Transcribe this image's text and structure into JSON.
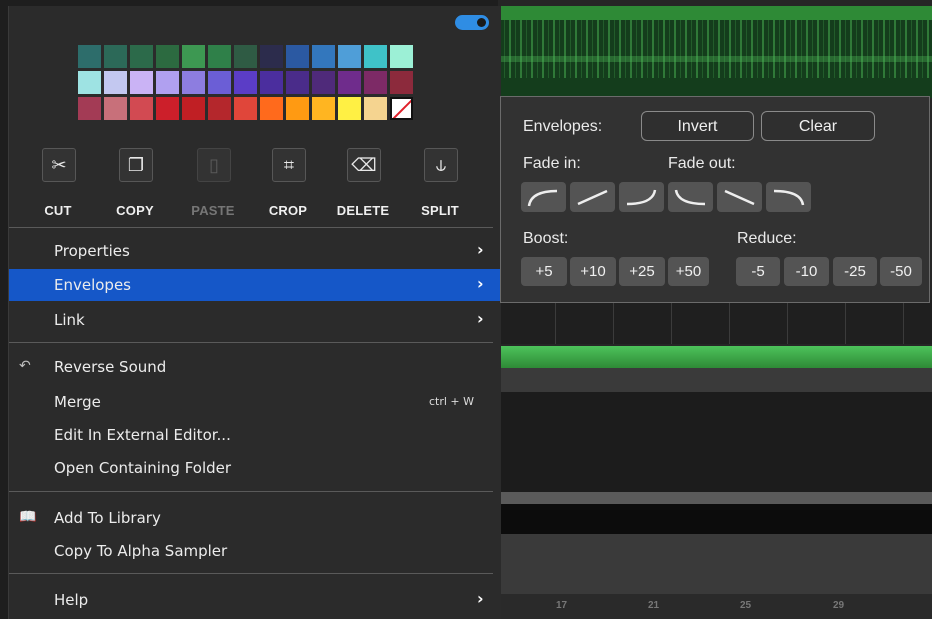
{
  "toggle": {
    "state": "on",
    "color": "#2f8de4"
  },
  "palette": {
    "rows": [
      [
        "#2d6d6b",
        "#2c6958",
        "#2c6a4a",
        "#2c6a40",
        "#3d9852",
        "#2f8049",
        "#2f5b44",
        "#2c2c4c",
        "#2b59a2",
        "#3377bd",
        "#4f9ed8",
        "#3fc2c8",
        "#9cf0d6"
      ],
      [
        "#9ee3e3",
        "#c3c8f0",
        "#cab3f5",
        "#b0a0f0",
        "#8d7de0",
        "#6b5ed6",
        "#5b3dc6",
        "#4b2e9e",
        "#4a2c8a",
        "#4f2a7a",
        "#6f2c8c",
        "#7d2a66",
        "#8c2a3c"
      ],
      [
        "#a33b55",
        "#c8707a",
        "#d24a52",
        "#cc1f2a",
        "#c01f24",
        "#b4272c",
        "#e0463a",
        "#ff6a1c",
        "#ff9a12",
        "#ffb521",
        "#fff044",
        "#f5d490",
        "none"
      ]
    ]
  },
  "tools": [
    {
      "label": "CUT",
      "icon": "scissors-icon",
      "glyph": "✂",
      "enabled": true
    },
    {
      "label": "COPY",
      "icon": "copy-icon",
      "glyph": "❐",
      "enabled": true
    },
    {
      "label": "PASTE",
      "icon": "clipboard-icon",
      "glyph": "▯",
      "enabled": false
    },
    {
      "label": "CROP",
      "icon": "crop-icon",
      "glyph": "⌗",
      "enabled": true
    },
    {
      "label": "DELETE",
      "icon": "backspace-icon",
      "glyph": "⌫",
      "enabled": true
    },
    {
      "label": "SPLIT",
      "icon": "split-icon",
      "glyph": "⫝",
      "enabled": true
    }
  ],
  "menu": {
    "properties": "Properties",
    "envelopes": "Envelopes",
    "link": "Link",
    "reverse": "Reverse Sound",
    "merge": "Merge",
    "merge_shortcut": "ctrl + W",
    "edit_external": "Edit In External Editor...",
    "open_folder": "Open Containing Folder",
    "add_library": "Add To Library",
    "copy_alpha": "Copy To Alpha Sampler",
    "help": "Help",
    "arrow": "›",
    "highlight_color": "#1557c8"
  },
  "envelopes_panel": {
    "title": "Envelopes:",
    "invert": "Invert",
    "clear": "Clear",
    "fade_in": "Fade in:",
    "fade_out": "Fade out:",
    "boost": "Boost:",
    "reduce": "Reduce:",
    "boost_values": [
      "+5",
      "+10",
      "+25",
      "+50"
    ],
    "reduce_values": [
      "-5",
      "-10",
      "-25",
      "-50"
    ]
  },
  "timeline_markers": [
    "17",
    "21",
    "25",
    "29"
  ]
}
